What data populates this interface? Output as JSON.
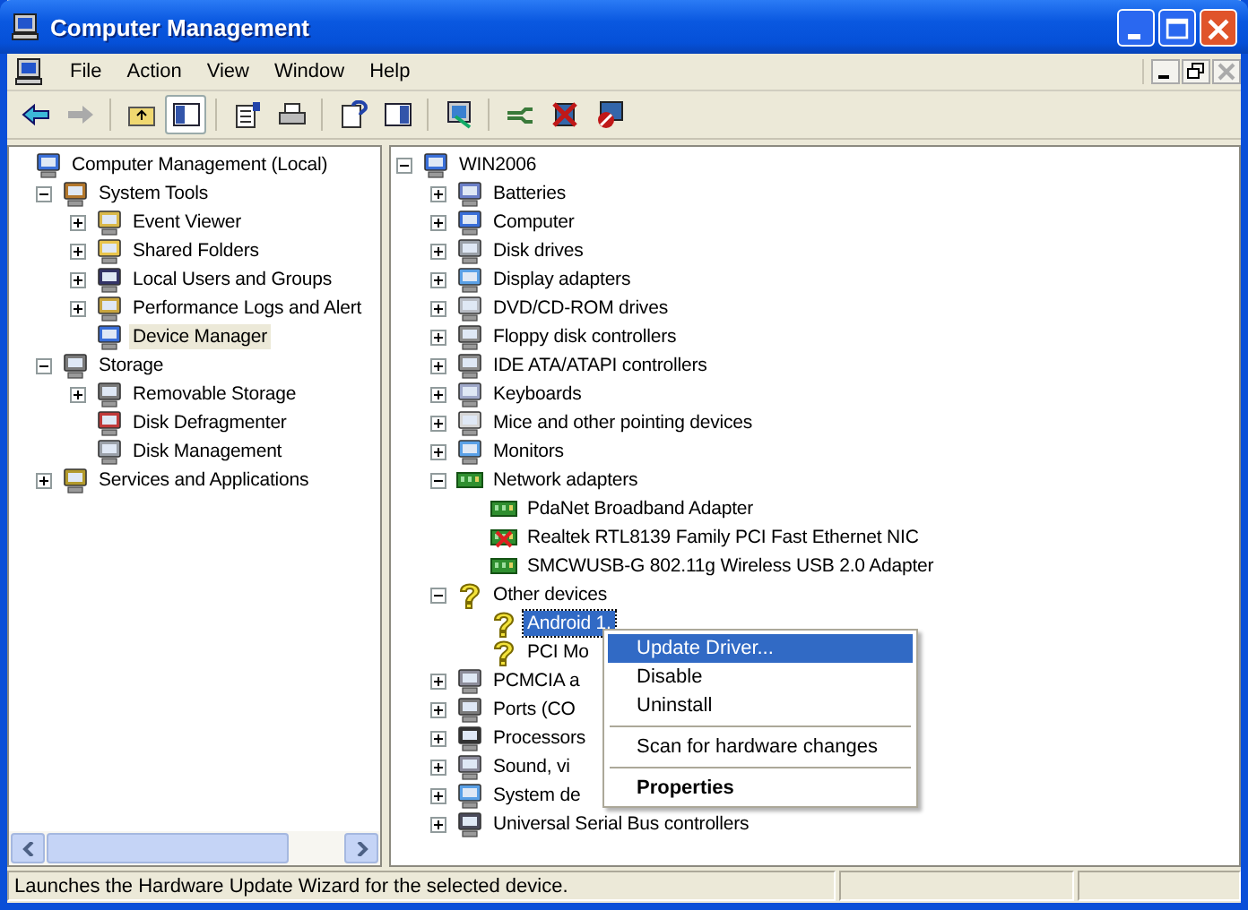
{
  "window": {
    "title": "Computer Management"
  },
  "menu_bar": [
    "File",
    "Action",
    "View",
    "Window",
    "Help"
  ],
  "left_tree": {
    "label": "Computer Management (Local)",
    "selected": false,
    "children": [
      {
        "label": "System Tools",
        "selected": false,
        "expanded": true,
        "children": [
          {
            "label": "Event Viewer",
            "selected": false,
            "expanded": false
          },
          {
            "label": "Shared Folders",
            "selected": false,
            "expanded": false
          },
          {
            "label": "Local Users and Groups",
            "selected": false,
            "expanded": false
          },
          {
            "label": "Performance Logs and Alert",
            "selected": false,
            "expanded": false
          },
          {
            "label": "Device Manager",
            "selected": true
          }
        ]
      },
      {
        "label": "Storage",
        "selected": false,
        "expanded": true,
        "children": [
          {
            "label": "Removable Storage",
            "selected": false,
            "expanded": false
          },
          {
            "label": "Disk Defragmenter",
            "selected": false
          },
          {
            "label": "Disk Management",
            "selected": false
          }
        ]
      },
      {
        "label": "Services and Applications",
        "selected": false,
        "expanded": false
      }
    ]
  },
  "device_tree": {
    "label": "WIN2006",
    "selected": false,
    "expanded": true,
    "children": [
      {
        "label": "Batteries",
        "selected": false,
        "expanded": false
      },
      {
        "label": "Computer",
        "selected": false,
        "expanded": false
      },
      {
        "label": "Disk drives",
        "selected": false,
        "expanded": false
      },
      {
        "label": "Display adapters",
        "selected": false,
        "expanded": false
      },
      {
        "label": "DVD/CD-ROM drives",
        "selected": false,
        "expanded": false
      },
      {
        "label": "Floppy disk controllers",
        "selected": false,
        "expanded": false
      },
      {
        "label": "IDE ATA/ATAPI controllers",
        "selected": false,
        "expanded": false
      },
      {
        "label": "Keyboards",
        "selected": false,
        "expanded": false
      },
      {
        "label": "Mice and other pointing devices",
        "selected": false,
        "expanded": false
      },
      {
        "label": "Monitors",
        "selected": false,
        "expanded": false
      },
      {
        "label": "Network adapters",
        "selected": false,
        "expanded": true,
        "children": [
          {
            "label": "PdaNet Broadband Adapter",
            "selected": false
          },
          {
            "label": "Realtek RTL8139 Family PCI Fast Ethernet NIC",
            "selected": false
          },
          {
            "label": "SMCWUSB-G 802.11g Wireless USB 2.0 Adapter",
            "selected": false
          }
        ]
      },
      {
        "label": "Other devices",
        "selected": false,
        "expanded": true,
        "children": [
          {
            "label": "Android 1.",
            "selected": true
          },
          {
            "label": "PCI Mo",
            "selected": false
          }
        ]
      },
      {
        "label": "PCMCIA a",
        "selected": false,
        "expanded": false
      },
      {
        "label": "Ports (CO",
        "selected": false,
        "expanded": false
      },
      {
        "label": "Processors",
        "selected": false,
        "expanded": false
      },
      {
        "label": "Sound, vi",
        "selected": false,
        "expanded": false
      },
      {
        "label": "System de",
        "selected": false,
        "expanded": false
      },
      {
        "label": "Universal Serial Bus controllers",
        "selected": false,
        "expanded": false
      }
    ]
  },
  "context_menu": [
    {
      "kind": "item",
      "label": "Update Driver...",
      "selected": true,
      "default": false
    },
    {
      "kind": "item",
      "label": "Disable",
      "selected": false,
      "default": false
    },
    {
      "kind": "item",
      "label": "Uninstall",
      "selected": false,
      "default": false
    },
    {
      "kind": "separator"
    },
    {
      "kind": "item",
      "label": "Scan for hardware changes",
      "selected": false,
      "default": false
    },
    {
      "kind": "separator"
    },
    {
      "kind": "item",
      "label": "Properties",
      "selected": false,
      "default": true
    }
  ],
  "status_bar": {
    "text": "Launches the Hardware Update Wizard for the selected device."
  }
}
